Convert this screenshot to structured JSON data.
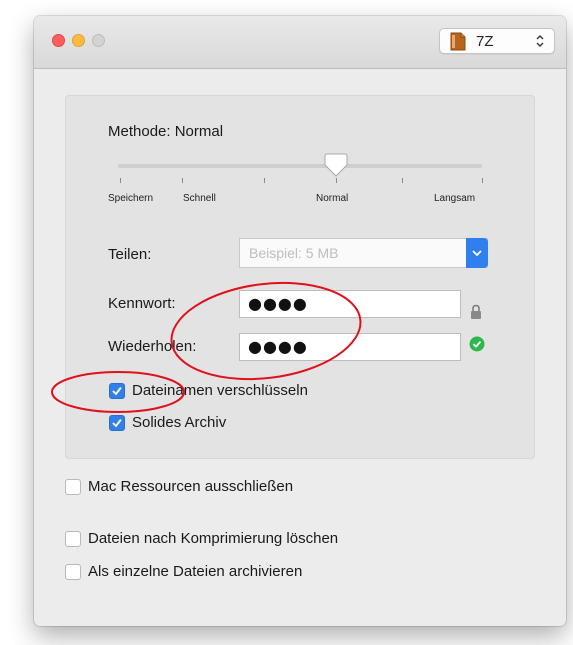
{
  "window": {
    "format_select": {
      "value": "7Z"
    }
  },
  "compression": {
    "method_label": "Methode: Normal",
    "slider": {
      "value": "Normal",
      "tick_labels": [
        "Speichern",
        "Schnell",
        "Normal",
        "Langsam"
      ]
    }
  },
  "split": {
    "label": "Teilen:",
    "placeholder": "Beispiel: 5 MB"
  },
  "password": {
    "label": "Kennwort:",
    "value": "●●●●"
  },
  "repeat": {
    "label": "Wiederholen:",
    "value": "●●●●"
  },
  "panel_options": [
    {
      "label": "Dateinamen verschlüsseln",
      "checked": true
    },
    {
      "label": "Solides Archiv",
      "checked": true
    }
  ],
  "options": [
    {
      "label": "Mac Ressourcen ausschließen",
      "checked": false
    },
    {
      "label": "Dateien nach Komprimierung löschen",
      "checked": false
    },
    {
      "label": "Als einzelne Dateien archivieren",
      "checked": false
    }
  ],
  "icons": {
    "archive": "zip-archive-icon",
    "lock": "lock-icon",
    "confirm": "check-circle-icon",
    "select_arrows": "updown-chevron-icon"
  },
  "colors": {
    "accent": "#2f7fe8",
    "success": "#2db84c",
    "annotation": "#e0111b"
  }
}
